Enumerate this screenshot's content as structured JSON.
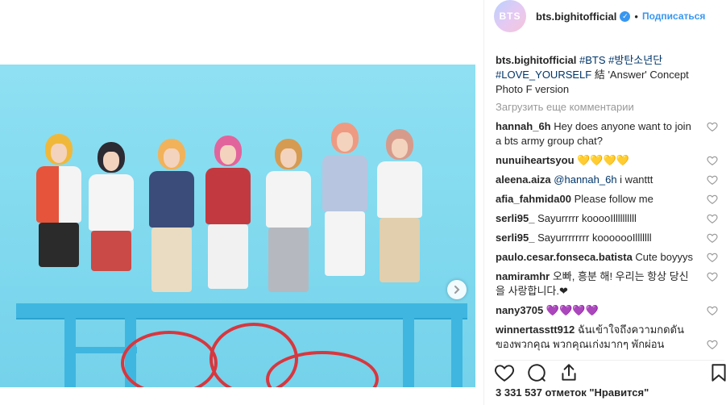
{
  "post": {
    "username": "bts.bighitofficial",
    "avatar_text": "BTS",
    "verified_glyph": "✓",
    "separator": "•",
    "follow_label": "Подписаться",
    "caption_user": "bts.bighitofficial",
    "caption_tags": [
      "#BTS",
      "#방탄소년단",
      "#LOVE_YOURSELF"
    ],
    "caption_text": " 結 'Answer' Concept Photo F version",
    "load_more": "Загрузить еще комментарии",
    "likes_text": "3 331 537 отметок \"Нравится\""
  },
  "comments": [
    {
      "user": "hannah_6h",
      "text": "Hey does anyone want to join a bts army group chat?"
    },
    {
      "user": "nunuiheartsyou",
      "text": "💛💛💛💛"
    },
    {
      "user": "aleena.aiza",
      "mention": "@hannah_6h",
      "text": " i wanttt"
    },
    {
      "user": "afia_fahmida00",
      "text": "Please follow me"
    },
    {
      "user": "serli95_",
      "text": "Sayurrrrr kooooIllllllllll"
    },
    {
      "user": "serli95_",
      "text": "Sayurrrrrrrr kooooooIlllllll"
    },
    {
      "user": "paulo.cesar.fonseca.batista",
      "text": "Cute boyyys"
    },
    {
      "user": "namiramhr",
      "text": "오빠, 흥분 해! 우리는 항상 당신을 사랑합니다.❤"
    },
    {
      "user": "nany3705",
      "text": "💜💜💜💜"
    },
    {
      "user": "winnertasstt912",
      "text": "ฉันเข้าใจถึงความกดดันของพวกคุณ พวกคุณเก่งมากๆ พักผ่อน"
    }
  ],
  "colors": {
    "accent": "#3897f0",
    "tag": "#003569",
    "muted": "#999999",
    "text": "#262626"
  },
  "icons": [
    "verified-icon",
    "heart-icon",
    "comment-icon",
    "share-icon",
    "bookmark-icon",
    "chevron-right-icon"
  ]
}
